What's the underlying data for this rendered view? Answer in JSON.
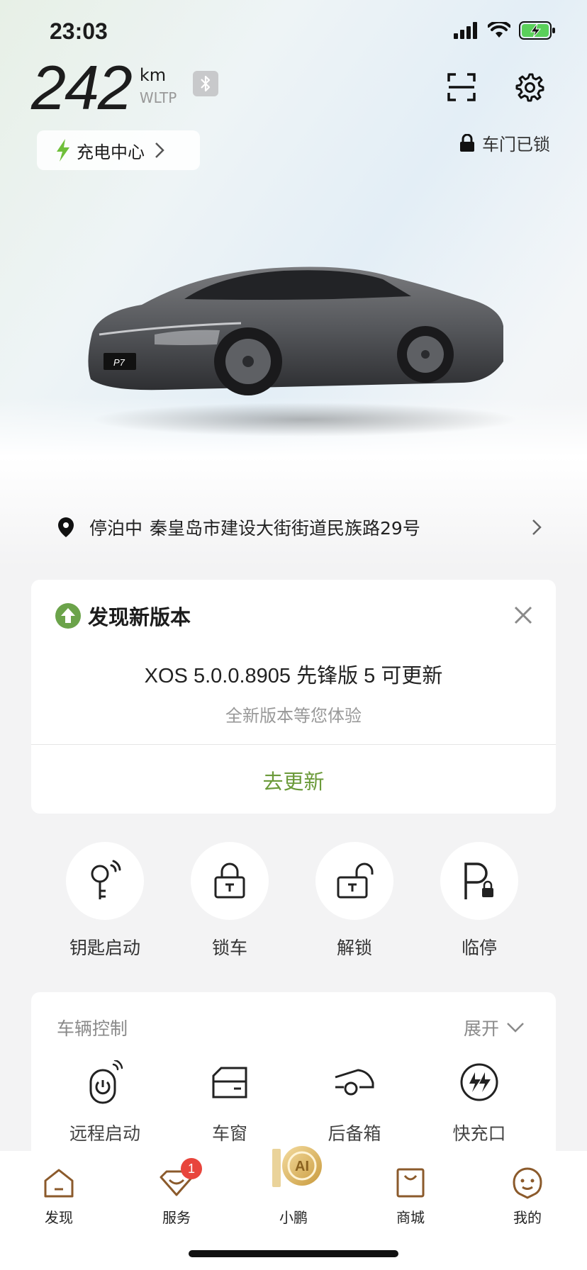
{
  "status_bar": {
    "time": "23:03"
  },
  "range": {
    "value": "242",
    "unit": "km",
    "standard": "WLTP"
  },
  "charge_center": {
    "label": "充电中心"
  },
  "door_status": {
    "label": "车门已锁"
  },
  "car": {
    "plate": "P7"
  },
  "location": {
    "status": "停泊中",
    "address": "秦皇岛市建设大街街道民族路29号"
  },
  "update": {
    "title": "发现新版本",
    "version_line": "XOS 5.0.0.8905 先锋版 5 可更新",
    "subtitle": "全新版本等您体验",
    "action": "去更新"
  },
  "quick_actions": [
    {
      "label": "钥匙启动",
      "icon": "key-start-icon"
    },
    {
      "label": "锁车",
      "icon": "lock-icon"
    },
    {
      "label": "解锁",
      "icon": "unlock-icon"
    },
    {
      "label": "临停",
      "icon": "temp-parking-icon"
    }
  ],
  "vehicle_control": {
    "title": "车辆控制",
    "expand": "展开",
    "items": [
      {
        "label": "远程启动",
        "icon": "remote-start-icon"
      },
      {
        "label": "车窗",
        "icon": "window-icon"
      },
      {
        "label": "后备箱",
        "icon": "trunk-icon"
      },
      {
        "label": "快充口",
        "icon": "fast-charge-port-icon"
      }
    ]
  },
  "tabbar": {
    "items": [
      {
        "label": "发现",
        "icon": "discover-icon"
      },
      {
        "label": "服务",
        "icon": "service-icon",
        "badge": "1"
      },
      {
        "label": "小鹏",
        "icon": "xpeng-ai-icon",
        "logo_text": "AI"
      },
      {
        "label": "商城",
        "icon": "mall-icon"
      },
      {
        "label": "我的",
        "icon": "profile-icon"
      }
    ]
  },
  "colors": {
    "accent_green": "#6b9a3a",
    "tab_brown": "#8b5a2b",
    "badge_red": "#e8453c"
  }
}
